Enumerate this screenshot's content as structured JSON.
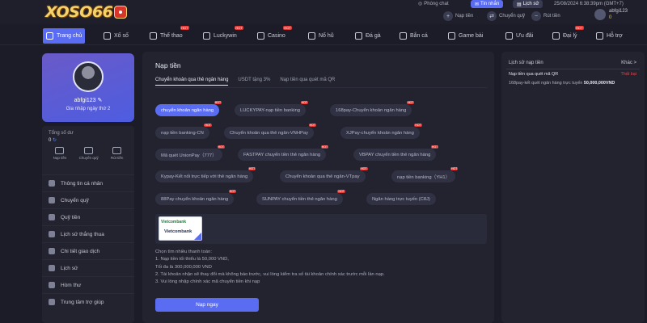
{
  "brand": {
    "logo_text": "XOSO66"
  },
  "topbar": {
    "phong_chat": "Phòng chat",
    "tin_nhan": "Tin nhắn",
    "lich_su": "Lịch sử",
    "datetime": "25/08/2024 6:38:39pm  (GMT+7)",
    "nap_tien": "Nạp tiền",
    "chuyen_quy": "Chuyển quỹ",
    "rut_tien": "Rút tiền",
    "username": "abfgi123",
    "balance": "0"
  },
  "nav": [
    {
      "label": "Trang chủ",
      "active": true,
      "hot": false
    },
    {
      "label": "Xổ số",
      "hot": false
    },
    {
      "label": "Thể thao",
      "hot": true
    },
    {
      "label": "Luckywin",
      "hot": true
    },
    {
      "label": "Casino",
      "hot": true
    },
    {
      "label": "Nổ hũ",
      "hot": false
    },
    {
      "label": "Đá gà",
      "hot": false
    },
    {
      "label": "Bắn cá",
      "hot": false
    },
    {
      "label": "Game bài",
      "hot": false
    },
    {
      "label": "Ưu đãi",
      "hot": false
    },
    {
      "label": "Đại lý",
      "hot": true
    },
    {
      "label": "Hỗ trợ",
      "hot": false
    }
  ],
  "hot_badge": "HOT",
  "profile": {
    "username": "abfgi123",
    "days": "Gia nhập ngày thứ 2"
  },
  "wallet": {
    "label": "Tổng số dư",
    "value": "0",
    "ops": [
      "Nạp tiền",
      "Chuyển quỹ",
      "Rút tiền"
    ]
  },
  "menu": [
    "Thông tin cá nhân",
    "Chuyển quỹ",
    "Quỹ tiền",
    "Lịch sử thắng thua",
    "Chi tiết giao dịch",
    "Lịch sử",
    "Hòm thư",
    "Trung tâm trợ giúp"
  ],
  "main": {
    "title": "Nạp tiền",
    "tabs": [
      "Chuyển khoản qua thẻ ngân hàng",
      "USDT tặng 3%",
      "Nạp tiền qua quét mã QR"
    ],
    "chips": [
      "chuyển khoản ngân hàng",
      "LUCKYPAY-nạp tiền banking",
      "168pay-Chuyển khoản ngân hàng",
      "nạp tiền banking-CN",
      "Chuyển khoản qua thẻ ngân-VNHPay",
      "XJPay-chuyển khoản ngân hàng",
      "Mã quét UnionPay（777）",
      "FASTPAY chuyển tiền thẻ ngân hàng",
      "VBPAY chuyển tiền thẻ ngân hàng",
      "Kypay-Kết nối trực tiếp với thẻ ngân hàng",
      "Chuyển khoản qua thẻ ngân-VTpay",
      "nạp tiền banking（YH1）",
      "88Pay chuyển khoản ngân hàng",
      "SUNPAY chuyển tiền thẻ ngân hàng",
      "Ngân hàng trực tuyến (C8J)"
    ],
    "bank": {
      "logo": "Vietcombank",
      "name": "Vietcombank"
    },
    "info_title": "Chọn tìm nhiều thanh toán:",
    "info_lines": [
      "1. Nạp tiền tối thiểu là 50,000 VND,",
      "Tối đa là 300,000,000 VND",
      "2. Tài khoản nhận sẽ thay đổi mà không báo trước, vui lòng kiểm tra số tài khoản chính xác trước mỗi lần nạp.",
      "3. Vui lòng nhập chính xác mã chuyển tiền khi nạp"
    ],
    "submit": "Nạp ngay"
  },
  "history": {
    "title": "Lịch sử nạp tiền",
    "close": "Khác >",
    "row1_name": "Nạp tiền qua quét mã QR",
    "row1_status": "Thất bại",
    "row2_text": "168pay-kết quét ngân hàng trực tuyến",
    "row2_amount": "50,000,000VND"
  },
  "colors": {
    "accent": "#5a6cf2",
    "background": "#1b1c27",
    "panel": "#22232f",
    "fail": "#e64545"
  }
}
